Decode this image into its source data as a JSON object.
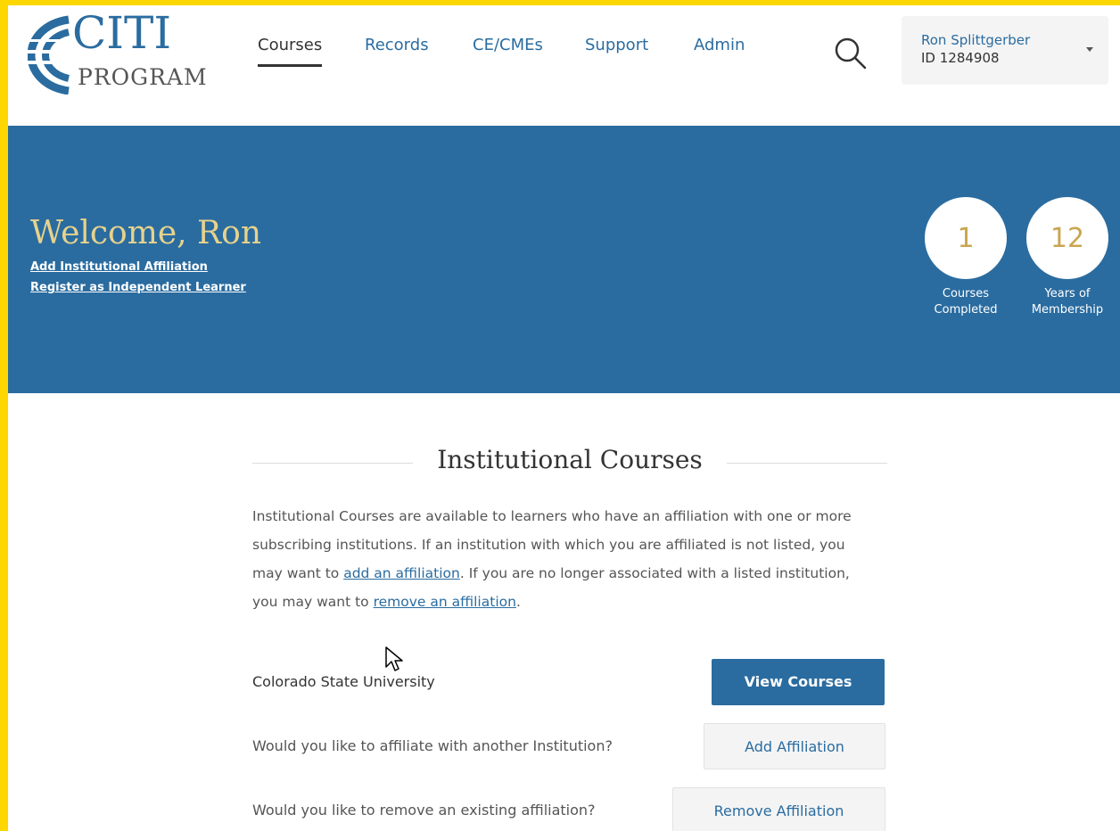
{
  "header": {
    "logo": {
      "top_text": "CITI",
      "bottom_text": "PROGRAM"
    },
    "nav": [
      {
        "label": "Courses",
        "active": true
      },
      {
        "label": "Records",
        "active": false
      },
      {
        "label": "CE/CMEs",
        "active": false
      },
      {
        "label": "Support",
        "active": false
      },
      {
        "label": "Admin",
        "active": false
      }
    ],
    "search_icon": "search-icon",
    "user": {
      "name": "Ron Splittgerber",
      "id_text": "ID 1284908"
    }
  },
  "banner": {
    "welcome": "Welcome, Ron",
    "links": [
      "Add Institutional Affiliation",
      "Register as Independent Learner"
    ],
    "stats": [
      {
        "value": "1",
        "label_line1": "Courses",
        "label_line2": "Completed"
      },
      {
        "value": "12",
        "label_line1": "Years of",
        "label_line2": "Membership"
      }
    ]
  },
  "content": {
    "title": "Institutional Courses",
    "intro": {
      "part1": "Institutional Courses are available to learners who have an affiliation with one or more subscribing institutions. If an institution with which you are affiliated is not listed, you may want to ",
      "link1": "add an affiliation",
      "part2": ". If you are no longer associated with a listed institution, you may want to ",
      "link2": "remove an affiliation",
      "part3": "."
    },
    "institution": {
      "name": "Colorado State University",
      "button": "View Courses"
    },
    "affiliate_prompt": {
      "text": "Would you like to affiliate with another Institution?",
      "button": "Add Affiliation"
    },
    "remove_prompt": {
      "text": "Would you like to remove an existing affiliation?",
      "button": "Remove Affiliation"
    }
  },
  "colors": {
    "brand_blue": "#2a6ca0",
    "welcome_gold": "#e7d28c",
    "stat_gold": "#c9a550",
    "frame_yellow": "#ffd700"
  }
}
